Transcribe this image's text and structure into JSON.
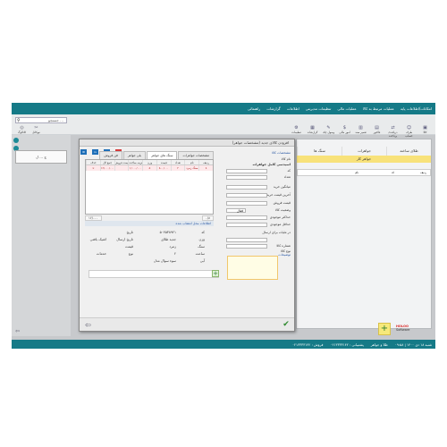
{
  "menu": [
    "امکانات/اطلاعات پایه",
    "عملیات مرتبط به کالا",
    "عملیات مالی",
    "تنظیمات مدیریتی",
    "اطلاعات",
    "گزارشات",
    "راهنمائی"
  ],
  "search": {
    "placeholder": "جستجو ..."
  },
  "toolbar_left": [
    "کاتالوگ",
    "نیوکاتل"
  ],
  "toolbar_right": [
    "کالا",
    "طرف حساب",
    "دریافت/پرداخت",
    "فاکتور",
    "تعمیر سند",
    "امور مالی",
    "وصول چک",
    "گزارشات",
    "تنظیمات"
  ],
  "accordion_label": "ج ... ل",
  "background_tabs": [
    "طلای ساخته",
    "جواهرات",
    "سنگ ها"
  ],
  "background_gold_label": "جواهر کار",
  "background_row": {
    "col1": "ردیف",
    "col2": "کد",
    "col3": "نام"
  },
  "dialog": {
    "title": "افزودن کالای جدید (مشخصات جواهر)",
    "window_buttons": [
      "ID",
      "ru",
      "EN",
      "×"
    ],
    "inner_tabs": [
      "مشخصات جواهرات",
      "سنگ های جواهر",
      "بلی جواهر",
      "فن فروش"
    ],
    "table_headers": [
      "ردیف",
      "نام",
      "تعداد",
      "قیمت",
      "وزن",
      "هزینه ساخت",
      "قیمت فروش",
      "جمع کل",
      "حذف"
    ],
    "table_row": [
      "1",
      "سنگ زمرد",
      "۲",
      "۸۰۰/۰۰۰",
      "۵",
      "۱/۰۰۰/۰۰۰",
      "",
      "۱۶/۰۰۰/۰۰۰",
      "×"
    ],
    "totals": [
      "۰/۸",
      "۱۶/۰۰۰"
    ],
    "seller_header": "اطلاعات محل انتشاب شده",
    "seller_fields": [
      {
        "label": "کد",
        "value": "۵۰۴۵۳۸۹۲۱"
      },
      {
        "label": "وزن",
        "value": "جدید طلای"
      },
      {
        "label": "سنگ",
        "value": "زمرد"
      },
      {
        "label": "ساعت",
        "value": "۲"
      },
      {
        "label": "تاریخ",
        "value": ""
      },
      {
        "label": "تاریخ ارسال",
        "value": "اشیک بافتی"
      },
      {
        "label": "قیمت",
        "value": ""
      },
      {
        "label": "نوع",
        "value": "خدمات"
      },
      {
        "label": "آبی",
        "value": "سوء سوال مدل"
      }
    ],
    "right_fields": [
      {
        "label": "مشخصات کالا"
      },
      {
        "label": "نام کالا"
      },
      {
        "label": "اسیدسی کامل جواهرات"
      },
      {
        "label": "کد"
      },
      {
        "label": "تعداد"
      },
      {
        "label": "میانگین خرید"
      },
      {
        "label": "آخرین قیمت خرید"
      },
      {
        "label": "قیمت فروش"
      },
      {
        "label": "وضعیت کالا"
      },
      {
        "label": "فعال"
      },
      {
        "label": "حداکثر موجودی"
      },
      {
        "label": "حداقل موجودی"
      },
      {
        "label": "در ملیات برای ارسال"
      },
      {
        "label": "شماره کالا"
      },
      {
        "label": "نوع کالا"
      },
      {
        "label": "توضیحات"
      }
    ]
  },
  "status_bar": [
    "شنبه ۱۸ دی ۱۴۰۰ | ۰۹:۵۸",
    "طلا و جواهر",
    "پشتیبانی : ۰۲۱۳۳۳۳۱۴۲",
    "فروش : ۰۲۱۳۳۳۳۱۴۲"
  ],
  "brand": {
    "name": "HOLOO",
    "sub": "Software"
  }
}
